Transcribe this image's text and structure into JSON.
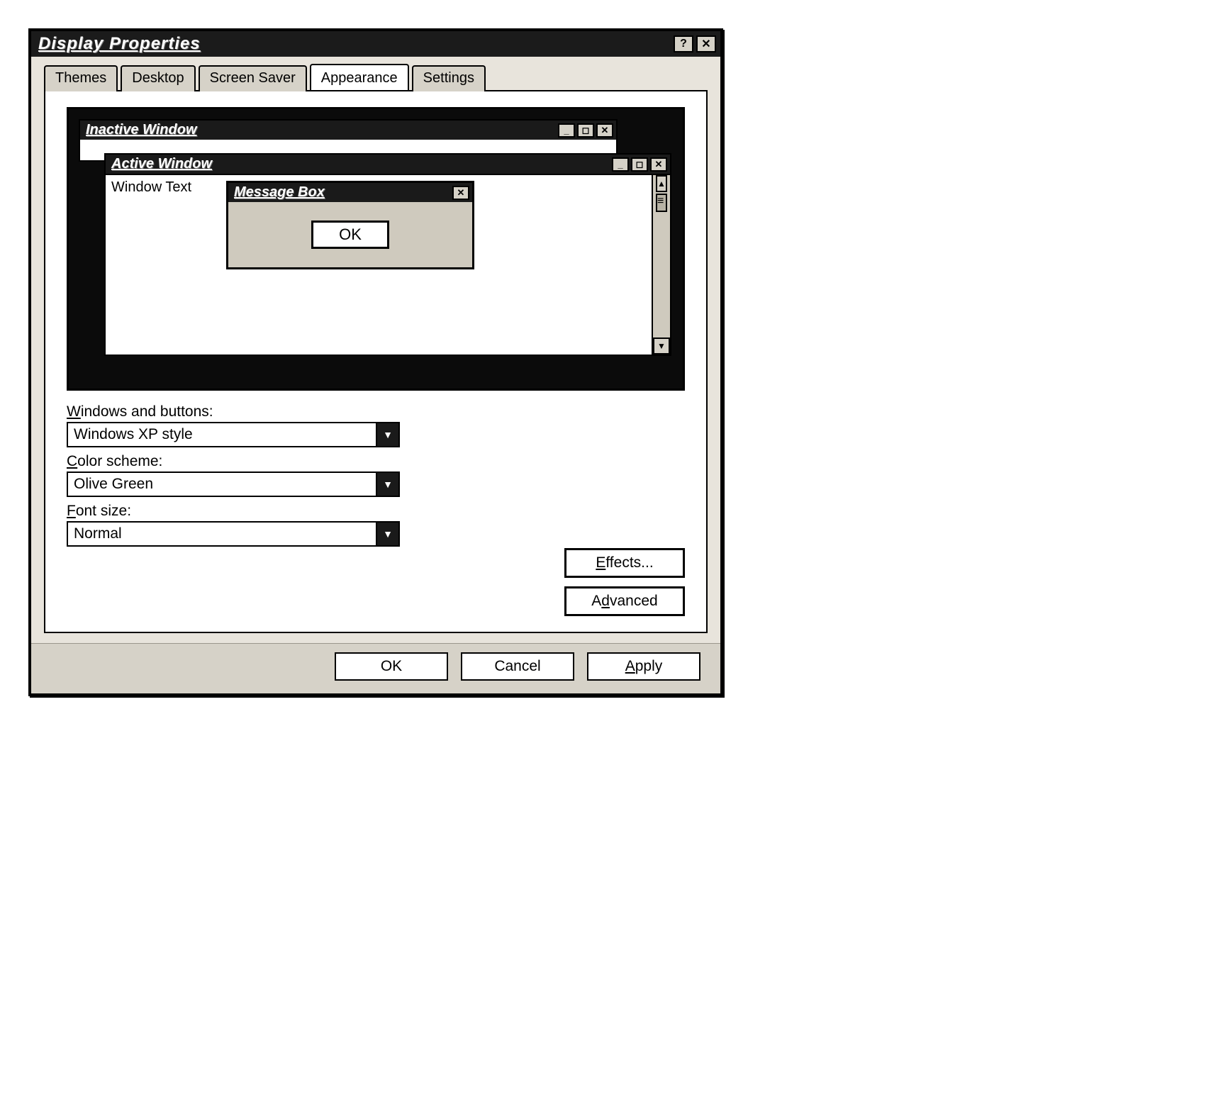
{
  "window": {
    "title": "Display Properties"
  },
  "tabs": {
    "themes": "Themes",
    "desktop": "Desktop",
    "screensaver": "Screen Saver",
    "appearance": "Appearance",
    "settings": "Settings"
  },
  "preview": {
    "inactive_title": "Inactive Window",
    "active_title": "Active Window",
    "window_text": "Window Text",
    "message_box_title": "Message Box",
    "message_box_ok": "OK"
  },
  "fields": {
    "windows_buttons_label": "Windows and buttons:",
    "windows_buttons_value": "Windows XP style",
    "color_scheme_label": "Color scheme:",
    "color_scheme_value": "Olive Green",
    "font_size_label": "Font size:",
    "font_size_value": "Normal"
  },
  "side_buttons": {
    "effects": "Effects...",
    "advanced": "Advanced"
  },
  "dialog_buttons": {
    "ok": "OK",
    "cancel": "Cancel",
    "apply": "Apply"
  }
}
